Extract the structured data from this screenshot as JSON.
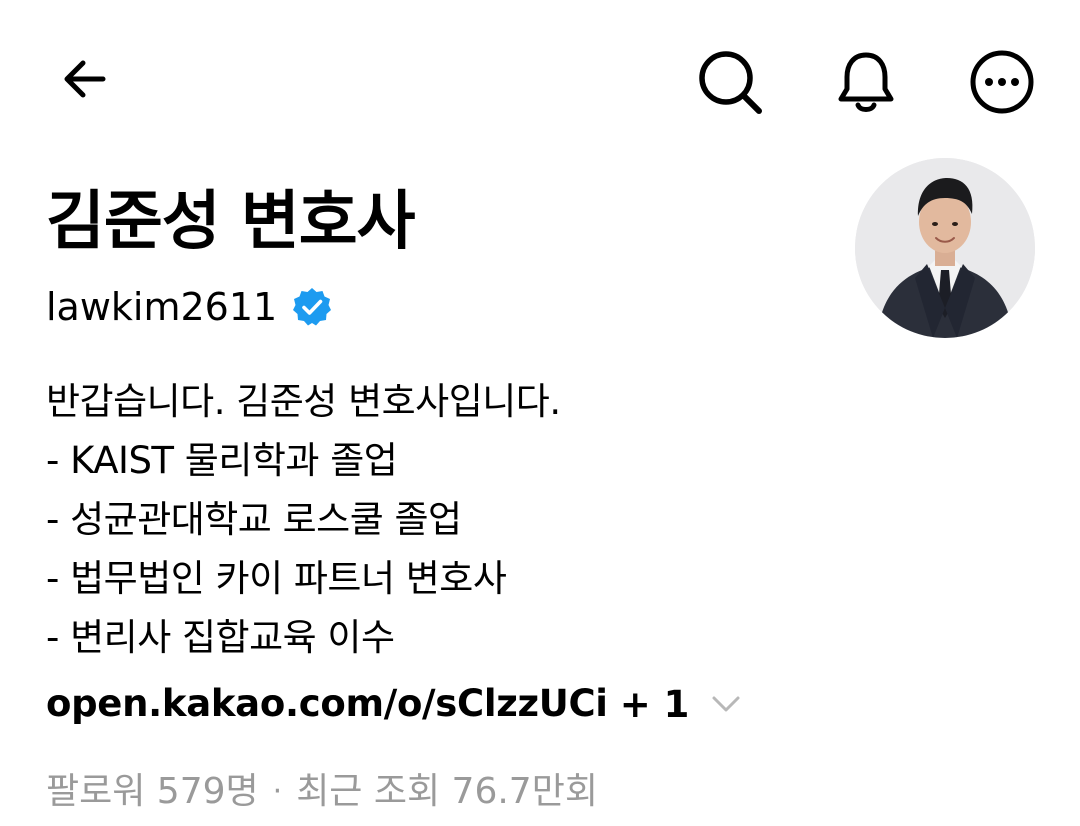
{
  "topbar": {
    "back_icon": "arrow-left-icon",
    "search_icon": "search-icon",
    "notifications_icon": "bell-icon",
    "more_icon": "more-circle-icon"
  },
  "profile": {
    "display_name": "김준성 변호사",
    "username": "lawkim2611",
    "verified_icon": "verified-badge-icon",
    "verified_color": "#1d9bf0",
    "avatar_icon": "profile-photo"
  },
  "bio": {
    "lines": [
      "반갑습니다. 김준성 변호사입니다.",
      "- KAIST 물리학과 졸업",
      "- 성균관대학교 로스쿨 졸업",
      "- 법무법인 카이 파트너 변호사",
      "- 변리사 집합교육 이수"
    ]
  },
  "links": {
    "primary": "open.kakao.com/o/sClzzUCi",
    "more_count": "+ 1",
    "expand_icon": "chevron-down-icon"
  },
  "stats": {
    "followers": "팔로워 579명",
    "separator": "·",
    "recent_views": "최근 조회 76.7만회"
  }
}
